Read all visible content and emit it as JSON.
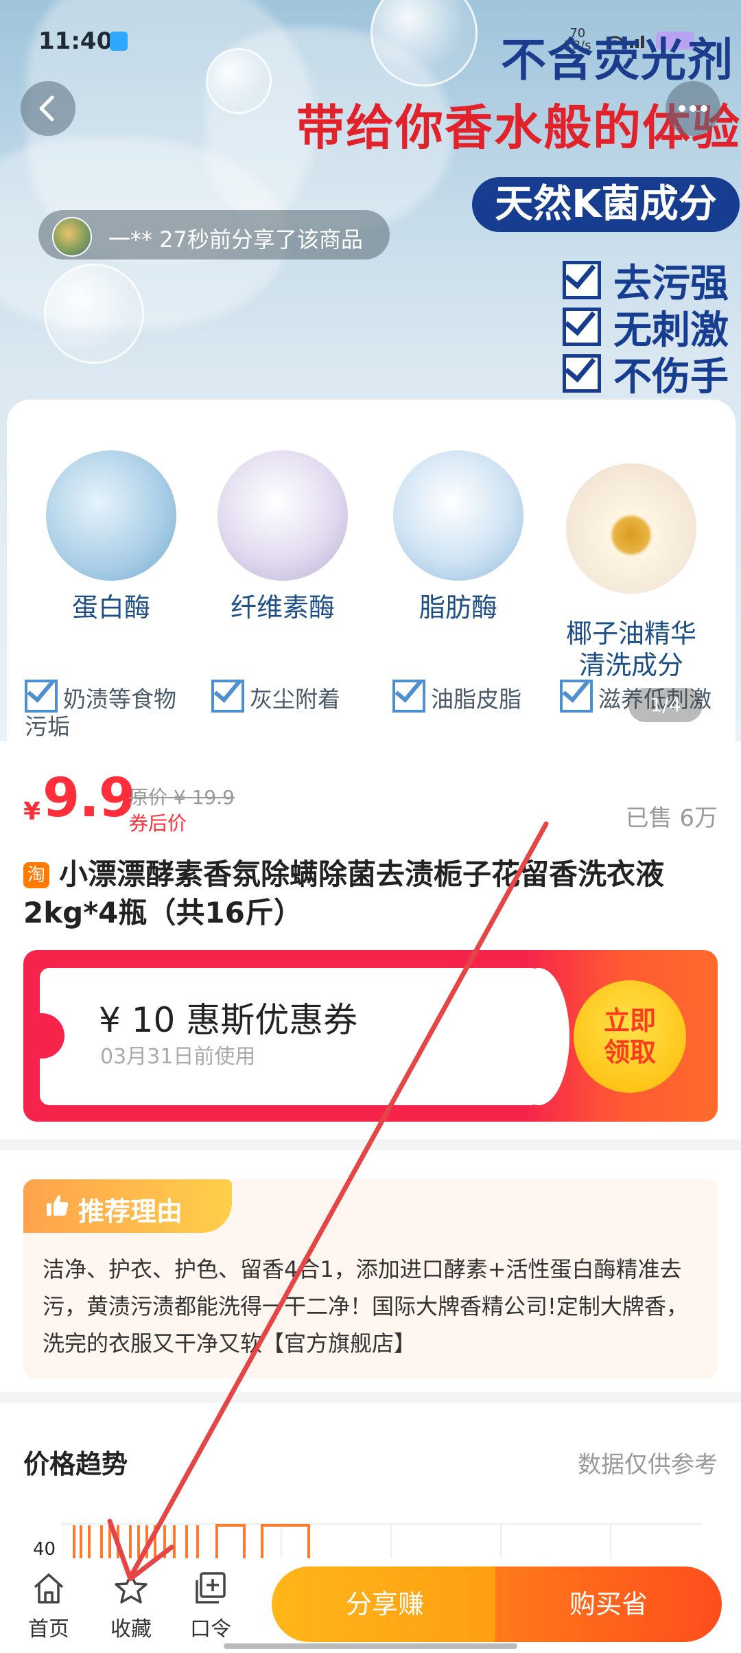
{
  "status_bar": {
    "time": "11:40",
    "net_speed_top": "70",
    "net_speed_unit": "KB/s"
  },
  "hero": {
    "title1": "不含荧光剂",
    "title2": "带给你香水般的体验",
    "tag": "天然K菌成分",
    "checks": [
      "去污强",
      "无刺激",
      "不伤手"
    ],
    "share_text": "一** 27秒前分享了该商品",
    "ingredients": [
      "蛋白酶",
      "纤维素酶",
      "脂肪酶",
      "椰子油精华\n清洗成分"
    ],
    "benefits": [
      "奶渍等食物\n污垢",
      "灰尘附着",
      "油脂皮脂",
      "滋养低刺激"
    ],
    "page_indicator": "1/4"
  },
  "product": {
    "currency": "¥",
    "price": "9.9",
    "original_price": "原价 ¥ 19.9",
    "coupon_price_label": "券后价",
    "sold": "已售 6万",
    "platform_badge": "淘",
    "title": "小漂漂酵素香氛除螨除菌去渍栀子花留香洗衣液2kg*4瓶（共16斤）"
  },
  "coupon": {
    "amount": "¥ 10 惠斯优惠券",
    "expiry": "03月31日前使用",
    "claim_label": "立即\n领取"
  },
  "recommend": {
    "title": "推荐理由",
    "text": "洁净、护衣、护色、留香4合1，添加进口酵素+活性蛋白酶精准去污，黄渍污渍都能洗得一干二净！国际大牌香精公司!定制大牌香，洗完的衣服又干净又软【官方旗舰店】"
  },
  "price_trend": {
    "title": "价格趋势",
    "note": "数据仅供参考",
    "y_label": "40"
  },
  "bottom_nav": {
    "home": "首页",
    "favorite": "收藏",
    "command": "口令",
    "share_earn": "分享赚",
    "buy_save": "购买省"
  },
  "colors": {
    "price_red": "#ff2e3a",
    "coupon_red": "#f6234b",
    "share_orange": "#ffb619",
    "buy_orange": "#ff4d1c",
    "hero_blue": "#163d8f",
    "annotation_red": "#e64545"
  }
}
